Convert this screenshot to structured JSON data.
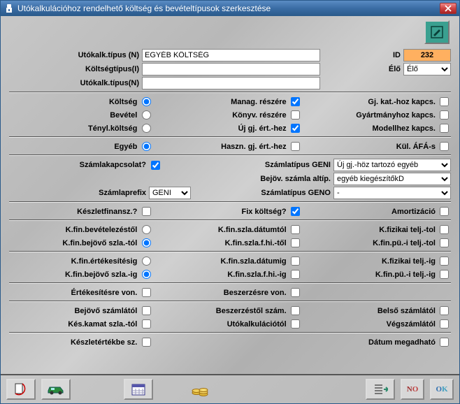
{
  "window": {
    "title": "Utókalkulációhoz rendelhető költség és bevételtípusok szerkesztése"
  },
  "header": {
    "utokalk_tipus_n_label": "Utókalk.típus (N)",
    "utokalk_tipus_n_value": "EGYÉB KÖLTSÉG",
    "koltsegtipus_label": "Költségtípus(I)",
    "koltsegtipus_value": "",
    "utokalk_tipus_name_label": "Utókalk.típus(N)",
    "utokalk_tipus_name_value": "",
    "id_label": "ID",
    "id_value": "232",
    "elo_label": "Élő",
    "elo_value": "Élő"
  },
  "section1": {
    "col1": [
      {
        "label": "Költség",
        "type": "radio",
        "checked": true
      },
      {
        "label": "Bevétel",
        "type": "radio",
        "checked": false
      },
      {
        "label": "Tényl.költség",
        "type": "radio",
        "checked": false
      },
      {
        "label": "Egyéb",
        "type": "radio",
        "checked": true
      }
    ],
    "col2": [
      {
        "label": "Manag. részére",
        "type": "check",
        "checked": true
      },
      {
        "label": "Könyv. részére",
        "type": "check",
        "checked": false
      },
      {
        "label": "Új gj. ért.-hez",
        "type": "check",
        "checked": true
      },
      {
        "label": "Haszn. gj. ért.-hez",
        "type": "check",
        "checked": false
      }
    ],
    "col3": [
      {
        "label": "Gj. kat.-hoz kapcs.",
        "type": "check",
        "checked": false
      },
      {
        "label": "Gyártmányhoz kapcs.",
        "type": "check",
        "checked": false
      },
      {
        "label": "Modellhez kapcs.",
        "type": "check",
        "checked": false
      },
      {
        "label": "Kül. ÁFÁ-s",
        "type": "check",
        "checked": false
      }
    ]
  },
  "section2": {
    "szamlakapcsolat_label": "Számlakapcsolat?",
    "szamlakapcsolat_checked": true,
    "szamlatipus_geni_label": "Számlatípus GENI",
    "szamlatipus_geni_value": "Új gj.-höz tartozó egyéb",
    "bejov_altip_label": "Bejöv. számla altíp.",
    "bejov_altip_value": "egyéb kiegészítőkD",
    "szamlaprefix_label": "Számlaprefix",
    "szamlaprefix_value": "GENI",
    "szamlatipus_geno_label": "Számlatípus GENO",
    "szamlatipus_geno_value": "-"
  },
  "section3": {
    "col1": [
      {
        "label": "Készletfinansz.?",
        "type": "check",
        "checked": false
      },
      {
        "label": "K.fin.bevételezéstől",
        "type": "radio",
        "checked": false
      },
      {
        "label": "K.fin.bejövő szla.-tól",
        "type": "radio",
        "checked": true
      },
      {
        "label": "K.fin.értékesítésig",
        "type": "radio",
        "checked": false
      },
      {
        "label": "K.fin.bejövő szla.-ig",
        "type": "radio",
        "checked": true
      }
    ],
    "col2": [
      {
        "label": "Fix költség?",
        "type": "check",
        "checked": true
      },
      {
        "label": "K.fin.szla.dátumtól",
        "type": "check",
        "checked": false
      },
      {
        "label": "K.fin.szla.f.hi.-től",
        "type": "check",
        "checked": false
      },
      {
        "label": "K.fin.szla.dátumig",
        "type": "check",
        "checked": false
      },
      {
        "label": "K.fin.szla.f.hi.-ig",
        "type": "check",
        "checked": false
      }
    ],
    "col3": [
      {
        "label": "Amortizáció",
        "type": "check",
        "checked": false
      },
      {
        "label": "K.fizikai telj.-tol",
        "type": "check",
        "checked": false
      },
      {
        "label": "K.fin.pü.-i telj.-tol",
        "type": "check",
        "checked": false
      },
      {
        "label": "K.fizikai telj.-ig",
        "type": "check",
        "checked": false
      },
      {
        "label": "K.fin.pü.-i telj.-ig",
        "type": "check",
        "checked": false
      }
    ]
  },
  "section4": {
    "col1": [
      {
        "label": "Értékesítésre von.",
        "type": "check",
        "checked": false
      },
      {
        "label": "Bejövő számlától",
        "type": "check",
        "checked": false
      },
      {
        "label": "Kés.kamat szla.-tól",
        "type": "check",
        "checked": false
      },
      {
        "label": "Készletértékbe sz.",
        "type": "check",
        "checked": false
      }
    ],
    "col2": [
      {
        "label": "Beszerzésre von.",
        "type": "check",
        "checked": false
      },
      {
        "label": "Beszerzéstől szám.",
        "type": "check",
        "checked": false
      },
      {
        "label": "Utókalkulációtól",
        "type": "check",
        "checked": false
      },
      {
        "label": "",
        "type": "none"
      }
    ],
    "col3": [
      {
        "label": "",
        "type": "none"
      },
      {
        "label": "Belső számlától",
        "type": "check",
        "checked": false
      },
      {
        "label": "Végszámlától",
        "type": "check",
        "checked": false
      },
      {
        "label": "Dátum megadható",
        "type": "check",
        "checked": false
      }
    ]
  },
  "toolbar": {
    "no": "NO",
    "ok": "OK"
  }
}
